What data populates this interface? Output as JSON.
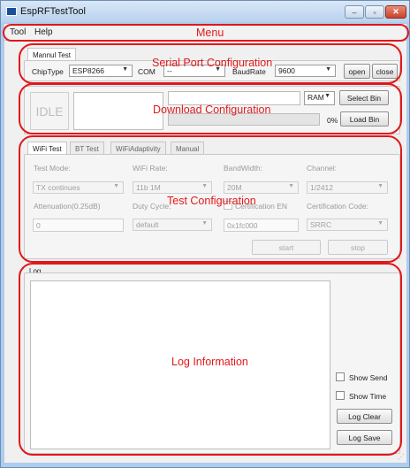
{
  "window": {
    "title": "EspRFTestTool",
    "minimize": "–",
    "maximize": "▫",
    "close": "✕"
  },
  "menu": {
    "items": [
      "Tool",
      "Help"
    ]
  },
  "annotations": {
    "menu": "Menu",
    "serial": "Serial Port Configuration",
    "download": "Download Configuration",
    "test": "Test Configuration",
    "log": "Log Information"
  },
  "serial": {
    "tab": "Mannul Test",
    "chiptype_label": "ChipType",
    "chiptype_value": "ESP8266",
    "com_label": "COM",
    "com_value": "--",
    "baud_label": "BaudRate",
    "baud_value": "9600",
    "open_label": "open",
    "close_label": "close"
  },
  "download": {
    "status": "IDLE",
    "ram_value": "RAM",
    "select_bin": "Select Bin",
    "percent": "0%",
    "load_bin": "Load Bin",
    "progress": 0
  },
  "test": {
    "tabs": [
      "WiFi Test",
      "BT Test",
      "WiFiAdaptivity",
      "Manual"
    ],
    "mode_label": "Test Mode:",
    "mode_value": "TX continues",
    "rate_label": "WiFi Rate:",
    "rate_value": "11b 1M",
    "bw_label": "BandWidth:",
    "bw_value": "20M",
    "channel_label": "Channel:",
    "channel_value": "1/2412",
    "atten_label": "Attenuation(0.25dB)",
    "atten_value": "0",
    "duty_label": "Duty Cycle:",
    "duty_value": "default",
    "cert_en_label": "Certification EN",
    "cert_en_value": "0x1fc000",
    "cert_code_label": "Certification Code:",
    "cert_code_value": "SRRC",
    "start": "start",
    "stop": "stop"
  },
  "log": {
    "label": "Log",
    "show_send": "Show Send",
    "show_time": "Show Time",
    "clear": "Log Clear",
    "save": "Log Save"
  },
  "colors": {
    "annotation": "#e3191b"
  }
}
